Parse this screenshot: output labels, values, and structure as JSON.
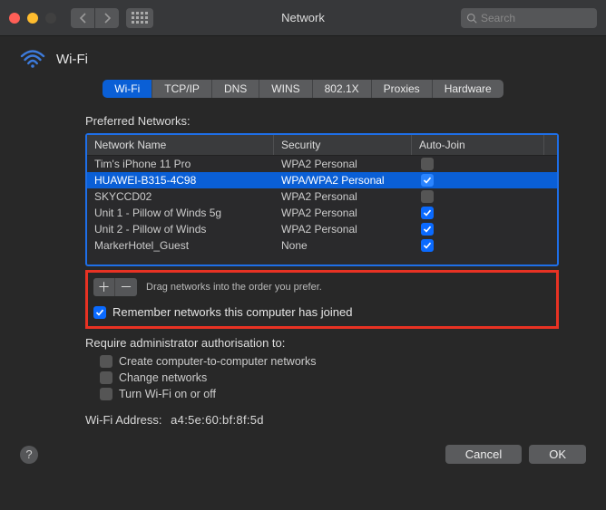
{
  "window": {
    "title": "Network",
    "search_placeholder": "Search"
  },
  "wifi_header": "Wi-Fi",
  "tabs": [
    {
      "label": "Wi-Fi",
      "active": true
    },
    {
      "label": "TCP/IP",
      "active": false
    },
    {
      "label": "DNS",
      "active": false
    },
    {
      "label": "WINS",
      "active": false
    },
    {
      "label": "802.1X",
      "active": false
    },
    {
      "label": "Proxies",
      "active": false
    },
    {
      "label": "Hardware",
      "active": false
    }
  ],
  "preferred_label": "Preferred Networks:",
  "columns": {
    "name": "Network Name",
    "security": "Security",
    "autojoin": "Auto-Join"
  },
  "networks": [
    {
      "name": "Tim's iPhone 11 Pro",
      "security": "WPA2 Personal",
      "autojoin": false,
      "selected": false
    },
    {
      "name": "HUAWEI-B315-4C98",
      "security": "WPA/WPA2 Personal",
      "autojoin": true,
      "selected": true
    },
    {
      "name": "SKYCCD02",
      "security": "WPA2 Personal",
      "autojoin": false,
      "selected": false
    },
    {
      "name": "Unit 1 - Pillow of Winds 5g",
      "security": "WPA2 Personal",
      "autojoin": true,
      "selected": false
    },
    {
      "name": "Unit 2 - Pillow of Winds",
      "security": "WPA2 Personal",
      "autojoin": true,
      "selected": false
    },
    {
      "name": "MarkerHotel_Guest",
      "security": "None",
      "autojoin": true,
      "selected": false
    }
  ],
  "drag_hint": "Drag networks into the order you prefer.",
  "remember_label": "Remember networks this computer has joined",
  "remember_checked": true,
  "admin_label": "Require administrator authorisation to:",
  "admin_options": [
    {
      "label": "Create computer-to-computer networks",
      "checked": false
    },
    {
      "label": "Change networks",
      "checked": false
    },
    {
      "label": "Turn Wi-Fi on or off",
      "checked": false
    }
  ],
  "wifi_address": {
    "label": "Wi-Fi Address:",
    "value": "a4:5e:60:bf:8f:5d"
  },
  "buttons": {
    "cancel": "Cancel",
    "ok": "OK",
    "help": "?"
  }
}
